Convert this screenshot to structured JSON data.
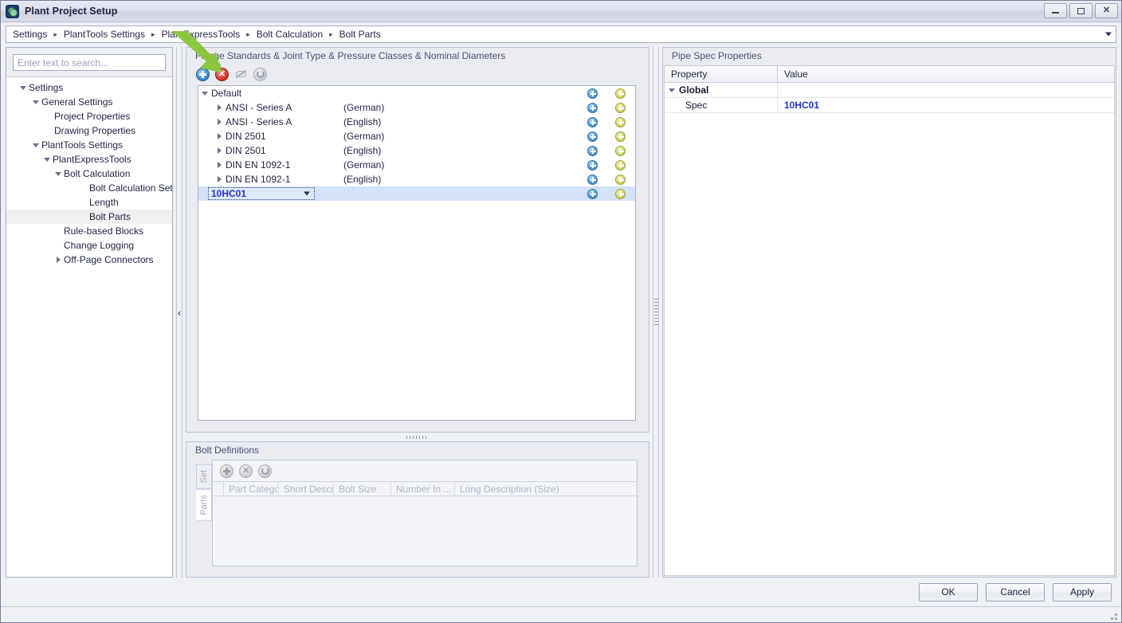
{
  "window": {
    "title": "Plant Project Setup",
    "icon": "plant-app-icon",
    "controls": {
      "minimize": "minimize-icon",
      "maximize": "maximize-icon",
      "close": "close-icon"
    }
  },
  "breadcrumb": {
    "items": [
      "Settings",
      "PlantTools Settings",
      "PlantExpressTools",
      "Bolt Calculation",
      "Bolt Parts"
    ],
    "separator": "▸",
    "dropdown_icon": "chevron-down-icon"
  },
  "sidebar": {
    "search": {
      "placeholder": "Enter text to search...",
      "value": ""
    },
    "tree": [
      {
        "label": "Settings",
        "indent": 0,
        "state": "expanded",
        "selected": false
      },
      {
        "label": "General Settings",
        "indent": 1,
        "state": "expanded",
        "selected": false
      },
      {
        "label": "Project Properties",
        "indent": 2,
        "state": "leaf",
        "selected": false
      },
      {
        "label": "Drawing Properties",
        "indent": 2,
        "state": "leaf",
        "selected": false
      },
      {
        "label": "PlantTools Settings",
        "indent": 1,
        "state": "expanded",
        "selected": false
      },
      {
        "label": "PlantExpressTools",
        "indent": 2,
        "state": "expanded",
        "selected": false
      },
      {
        "label": "Bolt Calculation",
        "indent": 3,
        "state": "expanded",
        "selected": false
      },
      {
        "label": "Bolt Calculation Setup",
        "indent": 4,
        "state": "leaf",
        "selected": false
      },
      {
        "label": "Length",
        "indent": 4,
        "state": "leaf",
        "selected": false
      },
      {
        "label": "Bolt Parts",
        "indent": 4,
        "state": "leaf",
        "selected": true
      },
      {
        "label": "Rule-based Blocks",
        "indent": 3,
        "state": "leaf",
        "selected": false
      },
      {
        "label": "Change Logging",
        "indent": 3,
        "state": "leaf",
        "selected": false
      },
      {
        "label": "Off-Page Connectors",
        "indent": 3,
        "state": "collapsed",
        "selected": false
      }
    ],
    "collapse_handle": "‹"
  },
  "flange_panel": {
    "title": "Flange Standards & Joint Type & Pressure Classes & Nominal Diameters",
    "toolbar": [
      {
        "name": "add-button",
        "icon": "plus-circle-blue-icon",
        "enabled": true
      },
      {
        "name": "delete-button",
        "icon": "delete-circle-red-icon",
        "enabled": true
      },
      {
        "name": "hide-button",
        "icon": "eye-slash-icon",
        "enabled": false
      },
      {
        "name": "refresh-button",
        "icon": "refresh-circle-icon",
        "enabled": false
      }
    ],
    "rows": [
      {
        "name": "Default",
        "language": "",
        "indent": 0,
        "state": "expanded",
        "selected": false,
        "editor": false
      },
      {
        "name": "ANSI - Series A",
        "language": "(German)",
        "indent": 1,
        "state": "collapsed",
        "selected": false,
        "editor": false
      },
      {
        "name": "ANSI - Series A",
        "language": "(English)",
        "indent": 1,
        "state": "collapsed",
        "selected": false,
        "editor": false
      },
      {
        "name": "DIN 2501",
        "language": "(German)",
        "indent": 1,
        "state": "collapsed",
        "selected": false,
        "editor": false
      },
      {
        "name": "DIN 2501",
        "language": "(English)",
        "indent": 1,
        "state": "collapsed",
        "selected": false,
        "editor": false
      },
      {
        "name": "DIN EN 1092-1",
        "language": "(German)",
        "indent": 1,
        "state": "collapsed",
        "selected": false,
        "editor": false
      },
      {
        "name": "DIN EN 1092-1",
        "language": "(English)",
        "indent": 1,
        "state": "collapsed",
        "selected": false,
        "editor": false
      },
      {
        "name": "10HC01",
        "language": "",
        "indent": 0,
        "state": "leaf",
        "selected": true,
        "editor": true
      }
    ],
    "row_icons": {
      "blue": "add-child-blue-icon",
      "yellow": "add-item-yellow-icon"
    }
  },
  "bolt_definitions": {
    "title": "Bolt Definitions",
    "side_tabs": [
      {
        "label": "Set",
        "active": false
      },
      {
        "label": "Parts",
        "active": true
      }
    ],
    "toolbar": [
      {
        "name": "add-part-button",
        "icon": "plus-circle-icon",
        "enabled": false
      },
      {
        "name": "delete-part-button",
        "icon": "delete-circle-icon",
        "enabled": false
      },
      {
        "name": "refresh-parts-button",
        "icon": "refresh-circle-icon",
        "enabled": false
      }
    ],
    "columns": [
      "Part Catego...",
      "Short Descri...",
      "Bolt Size",
      "Number In ...",
      "Long Description (Size)"
    ],
    "rows": []
  },
  "pipe_spec": {
    "title": "Pipe Spec  Properties",
    "columns": [
      "Property",
      "Value"
    ],
    "rows": [
      {
        "key": "Global",
        "value": "",
        "group": true,
        "state": "expanded",
        "link": false
      },
      {
        "key": "Spec",
        "value": "10HC01",
        "group": false,
        "state": "leaf",
        "link": true
      }
    ]
  },
  "footer": {
    "buttons": [
      "OK",
      "Cancel",
      "Apply"
    ]
  },
  "annotation": {
    "arrow_color": "#8cc63e"
  },
  "colors": {
    "accent_link": "#2433c5",
    "selection": "#d2e2f7",
    "window_bg": "#eef0f4",
    "panel_bg": "#e9ebf1"
  }
}
